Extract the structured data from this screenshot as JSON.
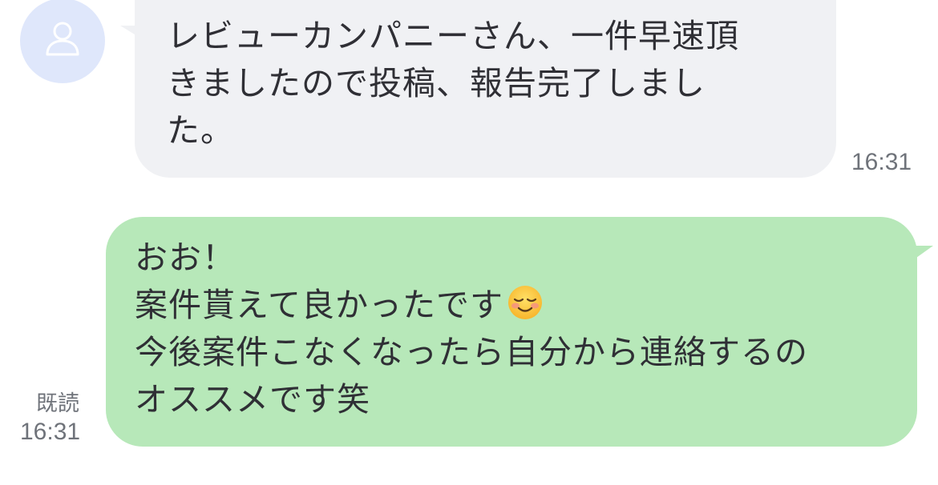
{
  "incoming": {
    "lines": [
      "レビューカンパニーさん、一件早速頂",
      "きましたので投稿、報告完了しまし",
      "た。"
    ],
    "time": "16:31"
  },
  "outgoing": {
    "lines": [
      "おお！",
      "案件貰えて良かったです",
      "今後案件こなくなったら自分から連絡するの",
      "オススメです笑"
    ],
    "read_label": "既読",
    "time": "16:31",
    "emoji": "smiling-face-icon"
  },
  "colors": {
    "incoming_bubble": "#f0f1f4",
    "outgoing_bubble": "#b7e8b9",
    "avatar_bg": "#dfe7fb",
    "avatar_icon": "#ffffff",
    "timestamp_text": "#6f737a"
  }
}
